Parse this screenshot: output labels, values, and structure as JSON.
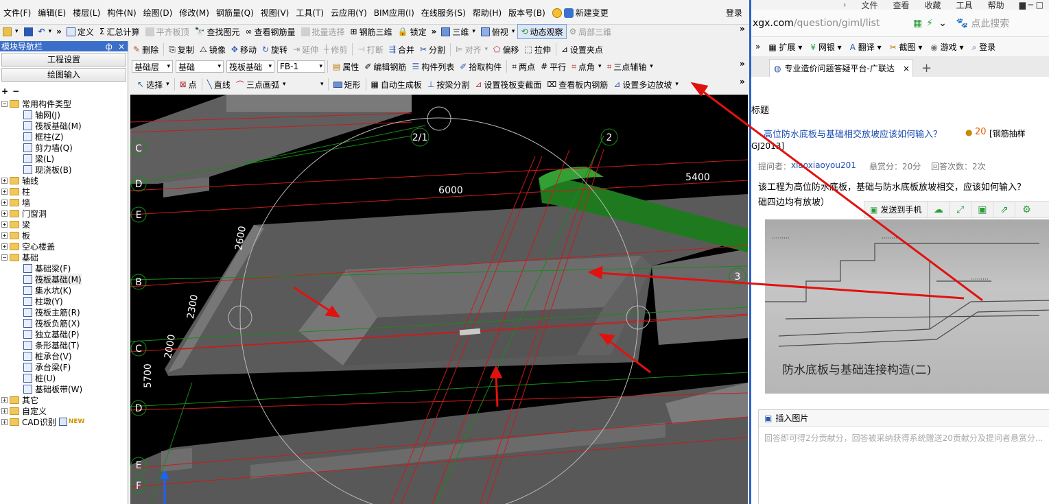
{
  "app": {
    "menu": [
      "文件(F)",
      "编辑(E)",
      "楼层(L)",
      "构件(N)",
      "绘图(D)",
      "修改(M)",
      "钢筋量(Q)",
      "视图(V)",
      "工具(T)",
      "云应用(Y)",
      "BIM应用(I)",
      "在线服务(S)",
      "帮助(H)",
      "版本号(B)"
    ],
    "new_change": "新建变更",
    "login": "登录",
    "toolbar1": {
      "define": "定义",
      "sum_calc": "汇总计算",
      "flush_top": "平齐板顶",
      "find_element": "查找图元",
      "view_rebar_qty": "查看钢筋量",
      "batch_select": "批量选择",
      "rebar_3d": "钢筋三维",
      "lock": "锁定",
      "three_d": "三维",
      "top_view": "俯视",
      "dynamic_view": "动态观察",
      "partial_3d": "局部三维"
    },
    "toolbar2": {
      "delete": "删除",
      "copy": "复制",
      "mirror": "镜像",
      "move": "移动",
      "rotate": "旋转",
      "extend": "延伸",
      "trim": "修剪",
      "break": "打断",
      "merge": "合并",
      "split": "分割",
      "align": "对齐",
      "offset": "偏移",
      "stretch": "拉伸",
      "set_grip": "设置夹点"
    },
    "toolbar3": {
      "floor_type": "基础层",
      "floor": "基础",
      "element_type": "筏板基础",
      "element": "FB-1",
      "properties": "属性",
      "edit_rebar": "编辑钢筋",
      "element_list": "构件列表",
      "pick_element": "拾取构件",
      "two_points": "两点",
      "parallel": "平行",
      "point_angle": "点角",
      "three_point_aux": "三点辅轴"
    },
    "toolbar4": {
      "select": "选择",
      "point": "点",
      "line": "直线",
      "arc": "三点画弧",
      "rect": "矩形",
      "auto_generate": "自动生成板",
      "split_by_beam": "按梁分割",
      "set_section_change": "设置筏板变截面",
      "view_slab_rebar": "查看板内钢筋",
      "set_multi_edge_slope": "设置多边放坡"
    }
  },
  "left_panel": {
    "title": "模块导航栏",
    "pin": "ф",
    "close": "×",
    "project_settings": "工程设置",
    "drawing_input": "绘图输入",
    "tree": [
      {
        "type": "folder",
        "label": "常用构件类型",
        "expanded": true,
        "level": 0
      },
      {
        "type": "leaf",
        "label": "轴网(J)",
        "level": 1
      },
      {
        "type": "leaf",
        "label": "筏板基础(M)",
        "level": 1
      },
      {
        "type": "leaf",
        "label": "框柱(Z)",
        "level": 1
      },
      {
        "type": "leaf",
        "label": "剪力墙(Q)",
        "level": 1
      },
      {
        "type": "leaf",
        "label": "梁(L)",
        "level": 1
      },
      {
        "type": "leaf",
        "label": "现浇板(B)",
        "level": 1
      },
      {
        "type": "folder",
        "label": "轴线",
        "expanded": false,
        "level": 0
      },
      {
        "type": "folder",
        "label": "柱",
        "expanded": false,
        "level": 0
      },
      {
        "type": "folder",
        "label": "墙",
        "expanded": false,
        "level": 0
      },
      {
        "type": "folder",
        "label": "门窗洞",
        "expanded": false,
        "level": 0
      },
      {
        "type": "folder",
        "label": "梁",
        "expanded": false,
        "level": 0
      },
      {
        "type": "folder",
        "label": "板",
        "expanded": false,
        "level": 0
      },
      {
        "type": "folder",
        "label": "空心楼盖",
        "expanded": false,
        "level": 0
      },
      {
        "type": "folder",
        "label": "基础",
        "expanded": true,
        "level": 0
      },
      {
        "type": "leaf",
        "label": "基础梁(F)",
        "level": 1
      },
      {
        "type": "leaf",
        "label": "筏板基础(M)",
        "level": 1,
        "selected": true
      },
      {
        "type": "leaf",
        "label": "集水坑(K)",
        "level": 1
      },
      {
        "type": "leaf",
        "label": "柱墩(Y)",
        "level": 1
      },
      {
        "type": "leaf",
        "label": "筏板主筋(R)",
        "level": 1
      },
      {
        "type": "leaf",
        "label": "筏板负筋(X)",
        "level": 1
      },
      {
        "type": "leaf",
        "label": "独立基础(P)",
        "level": 1
      },
      {
        "type": "leaf",
        "label": "条形基础(T)",
        "level": 1
      },
      {
        "type": "leaf",
        "label": "桩承台(V)",
        "level": 1
      },
      {
        "type": "leaf",
        "label": "承台梁(F)",
        "level": 1
      },
      {
        "type": "leaf",
        "label": "桩(U)",
        "level": 1
      },
      {
        "type": "leaf",
        "label": "基础板带(W)",
        "level": 1
      },
      {
        "type": "folder",
        "label": "其它",
        "expanded": false,
        "level": 0
      },
      {
        "type": "folder",
        "label": "自定义",
        "expanded": false,
        "level": 0
      },
      {
        "type": "folder",
        "label": "CAD识别",
        "expanded": false,
        "level": 0,
        "badge": "NEW"
      }
    ]
  },
  "viewport": {
    "axis_labels": [
      "D",
      "E",
      "B",
      "C",
      "D",
      "E",
      "F",
      "C"
    ],
    "axis_numbers": [
      "2/1",
      "2",
      "3"
    ],
    "dimensions": [
      "6000",
      "5400",
      "5700",
      "2600",
      "2300",
      "2000"
    ]
  },
  "browser": {
    "menu": [
      "文件",
      "查看",
      "收藏",
      "工具",
      "帮助"
    ],
    "url_host": "xgx.com",
    "url_path": "/question/giml/list",
    "search_placeholder": "点此搜索",
    "bookmarks": [
      "扩展",
      "网银",
      "翻译",
      "截图",
      "游戏",
      "登录"
    ],
    "tab_title": "专业造价问题答疑平台-广联达",
    "section": "标题",
    "question_title": "高位防水底板与基础相交放坡应该如何输入？",
    "reward_icon_value": "20",
    "category": "[钢筋抽样",
    "category2": "GJ2013]",
    "asker_label": "提问者：",
    "asker": "xiaoxiaoyou201",
    "bounty": "悬赏分：20分",
    "answers": "回答次数：2次",
    "question_body1": "该工程为高位防水底板，基础与防水底板放坡相交，应该如何输入？",
    "question_body2": "础四边均有放坡）",
    "send_to_phone": "发送到手机",
    "photo_caption": "防水底板与基础连接构造(二)",
    "insert_image": "插入图片",
    "answer_placeholder": "回答即可得2分贡献分，回答被采纳获得系统赠送20贡献分及提问者悬赏分..."
  },
  "colors": {
    "accent": "#3b6ec9",
    "annotation": "#e0120f",
    "beam": "#1f7a1f",
    "axis": "#1a8a1a",
    "grid_red": "#cc1a1a"
  }
}
